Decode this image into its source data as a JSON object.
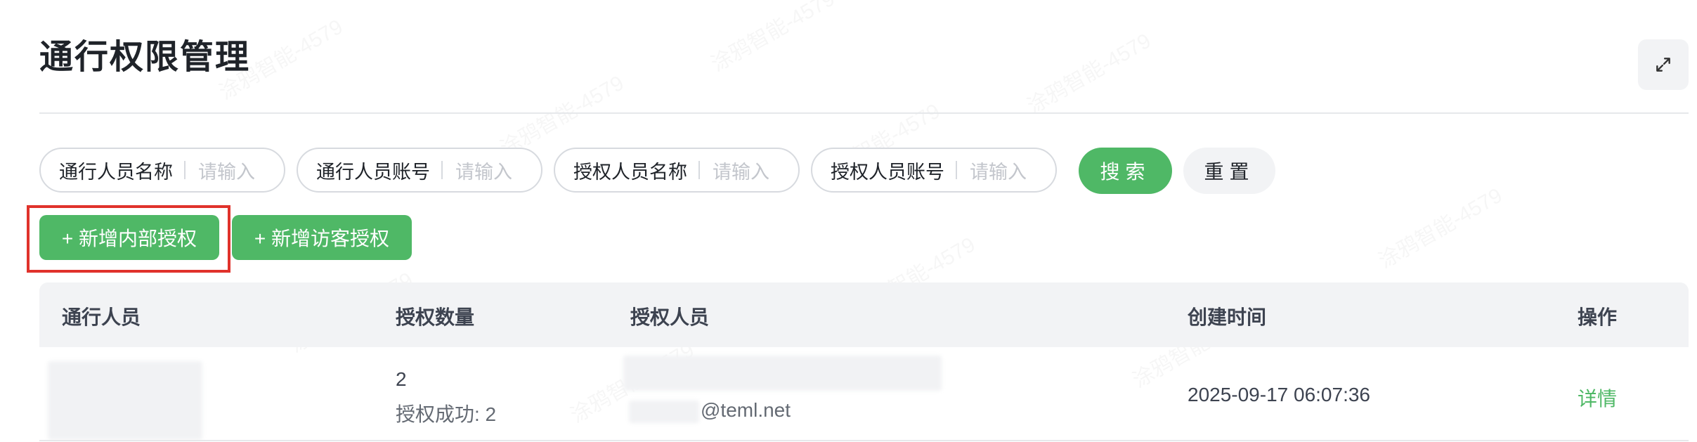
{
  "page": {
    "title": "通行权限管理"
  },
  "icons": {
    "expand": "expand-arrows-icon"
  },
  "colors": {
    "accent": "#4fb866",
    "highlight": "#e0322b"
  },
  "filters": [
    {
      "label": "通行人员名称",
      "placeholder": "请输入"
    },
    {
      "label": "通行人员账号",
      "placeholder": "请输入"
    },
    {
      "label": "授权人员名称",
      "placeholder": "请输入"
    },
    {
      "label": "授权人员账号",
      "placeholder": "请输入"
    }
  ],
  "actions": {
    "search": "搜索",
    "reset": "重置"
  },
  "add_buttons": {
    "internal": "+ 新增内部授权",
    "visitor": "+ 新增访客授权"
  },
  "table": {
    "columns": [
      "通行人员",
      "授权数量",
      "授权人员",
      "创建时间",
      "操作"
    ],
    "rows": [
      {
        "count": "2",
        "success": "授权成功: 2",
        "authorizer_email": "@teml.net",
        "created": "2025-09-17 06:07:36",
        "action": "详情"
      }
    ]
  },
  "watermark": "涂鸦智能-4579"
}
